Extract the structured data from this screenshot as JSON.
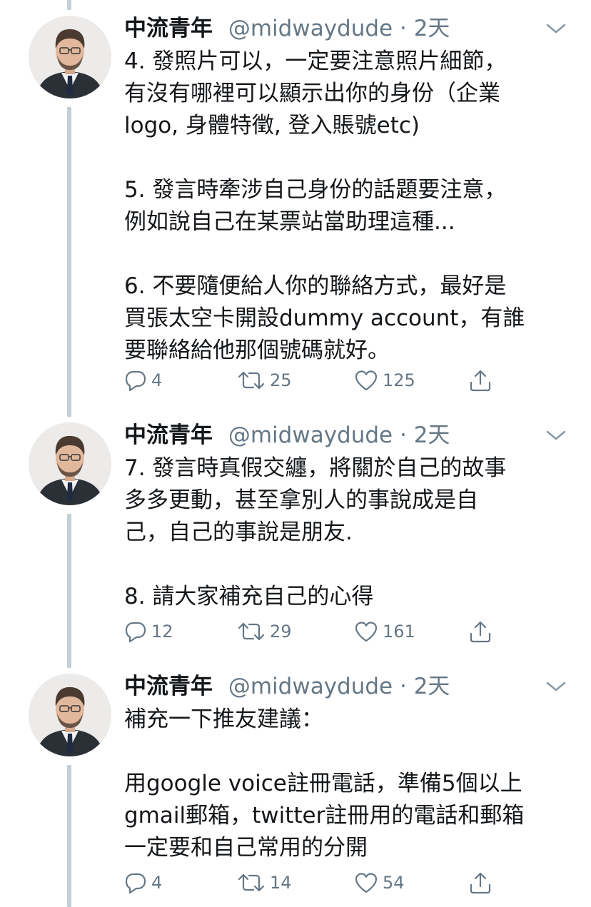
{
  "tweets": [
    {
      "name": "中流青年",
      "handle": "@midwaydude",
      "dot": "·",
      "time": "2天",
      "text": "4. 發照片可以，一定要注意照片細節，\n有沒有哪裡可以顯示出你的身份（企業\nlogo, 身體特徵, 登入賬號etc)\n\n5. 發言時牽涉自己身份的話題要注意，\n例如說自己在某票站當助理這種...\n\n6. 不要隨便給人你的聯絡方式，最好是\n買張太空卡開設dummy account，有誰\n要聯絡給他那個號碼就好。",
      "replies": "4",
      "retweets": "25",
      "likes": "125"
    },
    {
      "name": "中流青年",
      "handle": "@midwaydude",
      "dot": "·",
      "time": "2天",
      "text": "7. 發言時真假交纏，將關於自己的故事\n多多更動，甚至拿別人的事說成是自\n己，自己的事說是朋友.\n\n8. 請大家補充自己的心得",
      "replies": "12",
      "retweets": "29",
      "likes": "161"
    },
    {
      "name": "中流青年",
      "handle": "@midwaydude",
      "dot": "·",
      "time": "2天",
      "text": "補充一下推友建議：\n\n用google voice註冊電話，準備5個以上\ngmail郵箱，twitter註冊用的電話和郵箱\n一定要和自己常用的分開",
      "replies": "4",
      "retweets": "14",
      "likes": "54"
    }
  ],
  "icons": {
    "reply": "reply-icon",
    "retweet": "retweet-icon",
    "like": "heart-icon",
    "share": "share-icon",
    "caret": "chevron-down-icon",
    "avatar": "avatar"
  },
  "colors": {
    "text": "#14171a",
    "secondary": "#657786",
    "thread_line": "#c4cfd6",
    "background": "#ffffff"
  }
}
